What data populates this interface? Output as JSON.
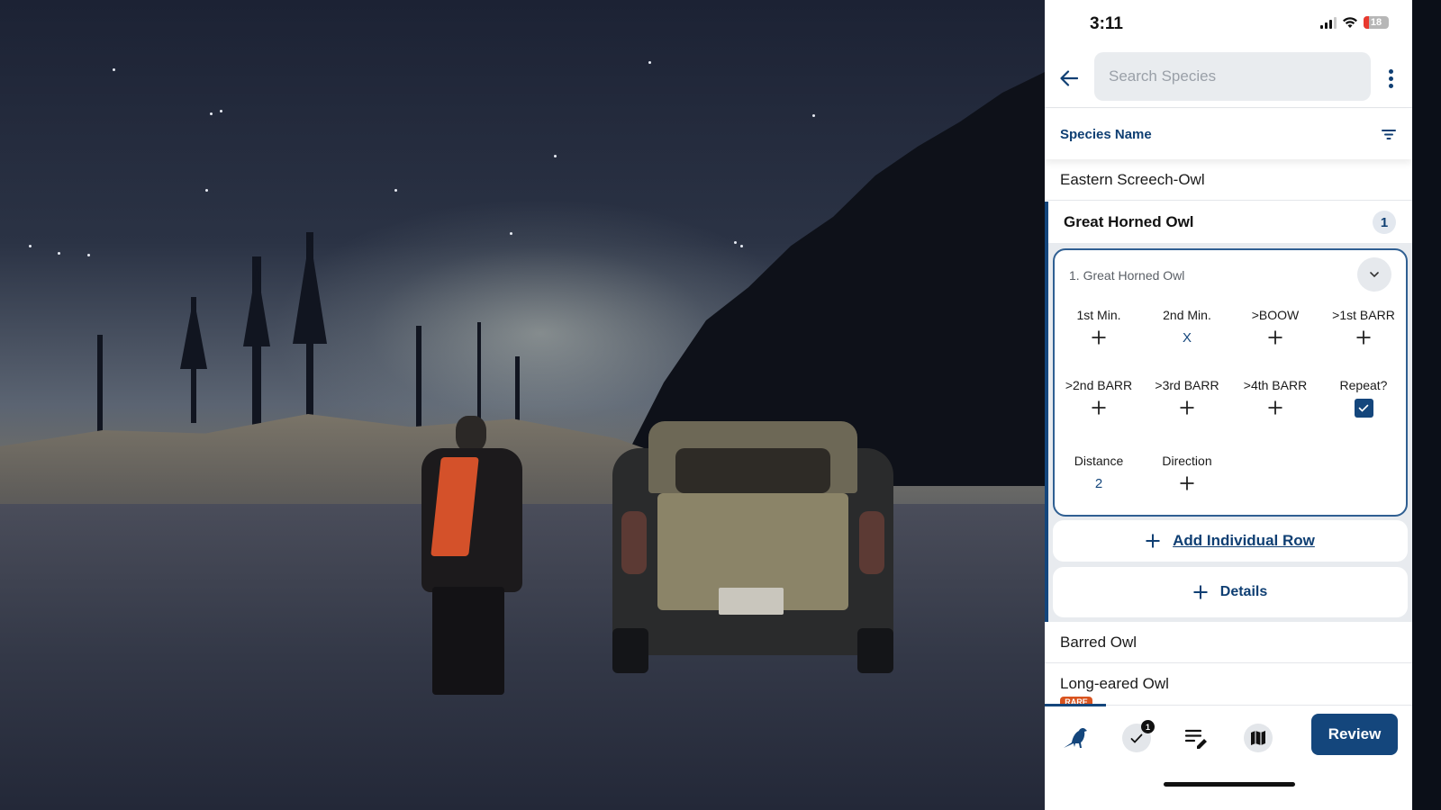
{
  "status_bar": {
    "time": "3:11",
    "battery": "18"
  },
  "search": {
    "placeholder": "Search Species",
    "value": ""
  },
  "list_header": {
    "title": "Species Name"
  },
  "species_above": [
    {
      "name": "Eastern Screech-Owl"
    }
  ],
  "expanded_species": {
    "name": "Great Horned Owl",
    "count": "1",
    "individual": {
      "title": "1. Great Horned Owl",
      "fields": [
        {
          "label": "1st Min.",
          "value": "+",
          "type": "plus"
        },
        {
          "label": "2nd Min.",
          "value": "X",
          "type": "text"
        },
        {
          "label": ">BOOW",
          "value": "+",
          "type": "plus"
        },
        {
          "label": ">1st BARR",
          "value": "+",
          "type": "plus"
        },
        {
          "label": ">2nd BARR",
          "value": "+",
          "type": "plus"
        },
        {
          "label": ">3rd BARR",
          "value": "+",
          "type": "plus"
        },
        {
          "label": ">4th BARR",
          "value": "+",
          "type": "plus"
        },
        {
          "label": "Repeat?",
          "value": true,
          "type": "checkbox"
        },
        {
          "label": "Distance",
          "value": "2",
          "type": "text"
        },
        {
          "label": "Direction",
          "value": "+",
          "type": "plus"
        }
      ]
    },
    "add_row_label": "Add Individual Row",
    "details_label": "Details"
  },
  "species_below": [
    {
      "name": "Barred Owl"
    },
    {
      "name": "Long-eared Owl",
      "badge": "RARE"
    }
  ],
  "bottom_nav": {
    "items": [
      {
        "name": "species",
        "icon": "bird-icon"
      },
      {
        "name": "checklist",
        "icon": "check-icon",
        "badge": "1"
      },
      {
        "name": "notes",
        "icon": "edit-list-icon"
      },
      {
        "name": "map",
        "icon": "map-icon"
      }
    ],
    "review_label": "Review"
  },
  "colors": {
    "primary": "#14467c",
    "heading": "#0f3f73",
    "rare": "#d9531e",
    "search_bg": "#e9ecef"
  }
}
